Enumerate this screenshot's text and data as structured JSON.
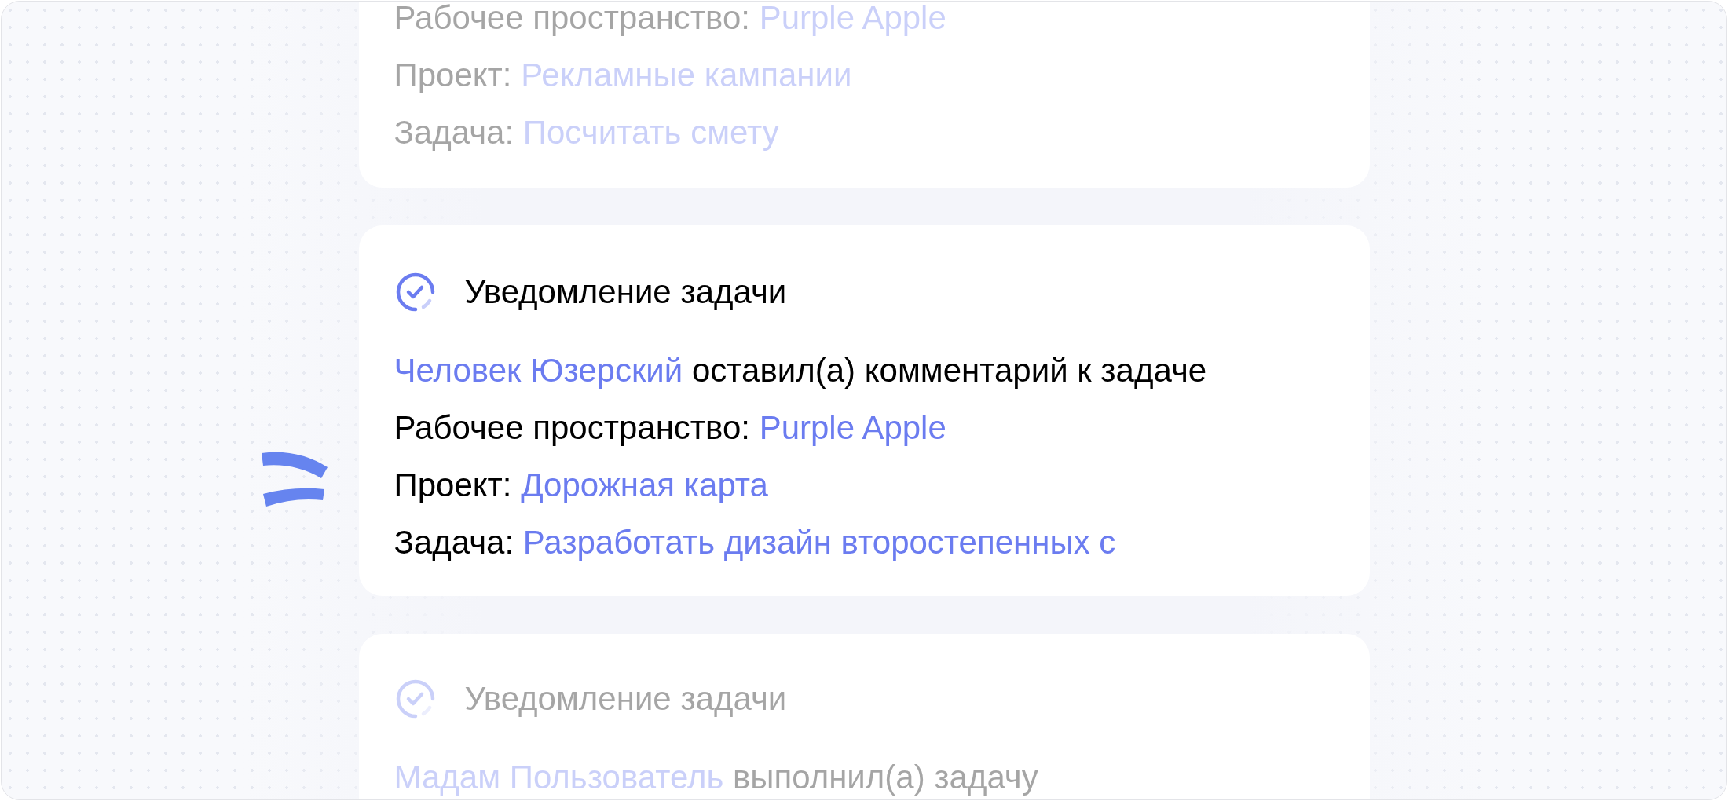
{
  "cards": [
    {
      "dimmed": true,
      "lines": [
        {
          "kind": "field",
          "label": "Рабочее пространство:",
          "value": "Purple Apple"
        },
        {
          "kind": "field",
          "label": "Проект:",
          "value": "Рекламные кампании"
        },
        {
          "kind": "field",
          "label": "Задача:",
          "value": "Посчитать смету"
        }
      ]
    },
    {
      "dimmed": false,
      "title": "Уведомление задачи",
      "lines": [
        {
          "kind": "event",
          "actor": "Человек Юзерский",
          "action": "оставил(а) комментарий к задаче"
        },
        {
          "kind": "field",
          "label": "Рабочее пространство:",
          "value": "Purple Apple"
        },
        {
          "kind": "field",
          "label": "Проект:",
          "value": "Дорожная карта"
        },
        {
          "kind": "field",
          "label": "Задача:",
          "value": "Разработать дизайн второстепенных с"
        }
      ]
    },
    {
      "dimmed": true,
      "title": "Уведомление задачи",
      "lines": [
        {
          "kind": "event",
          "actor": "Мадам Пользователь",
          "action": "выполнил(а) задачу"
        }
      ]
    }
  ]
}
